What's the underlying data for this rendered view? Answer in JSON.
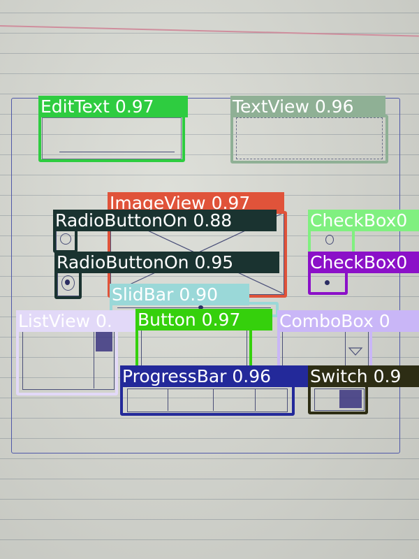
{
  "colors": {
    "edittext": "#2ecc40",
    "textview": "#8fb095",
    "imageview": "#e0533a",
    "radiobutton": "#1a3330",
    "checkbox_a": "#80f080",
    "checkbox_b": "#8b10c8",
    "slidbar": "#9ad8d8",
    "listview": "#e2d9f8",
    "button": "#35d00c",
    "combobox": "#c9b6f7",
    "progressbar": "#23299a",
    "switch": "#2d2d14"
  },
  "detections": {
    "edittext": "EditText 0.97",
    "textview": "TextView 0.96",
    "imageview": "ImageView 0.97",
    "radio1": "RadioButtonOn 0.88",
    "checkbox1": "CheckBox0",
    "radio2": "RadioButtonOn 0.95",
    "checkbox2": "CheckBox0",
    "slidbar": "SlidBar 0.90",
    "listview": "ListView 0.",
    "button": "Button 0.97",
    "combobox": "ComboBox 0",
    "progressbar": "ProgressBar 0.96",
    "switch": "Switch 0.9"
  }
}
